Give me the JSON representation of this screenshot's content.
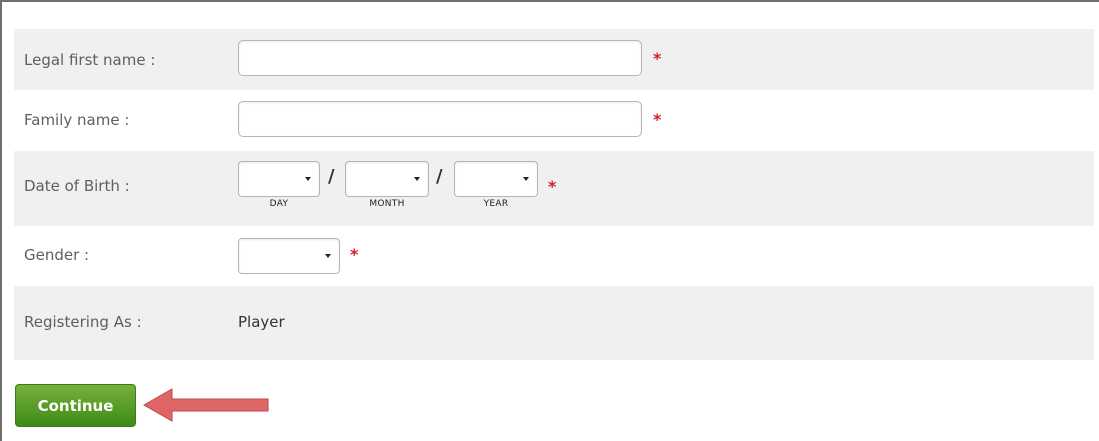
{
  "form": {
    "first_name": {
      "label": "Legal first name :",
      "value": "",
      "required_marker": "*"
    },
    "family_name": {
      "label": "Family name :",
      "value": "",
      "required_marker": "*"
    },
    "dob": {
      "label": "Date of Birth :",
      "separator": "/",
      "day_caption": "DAY",
      "month_caption": "MONTH",
      "year_caption": "YEAR",
      "required_marker": "*"
    },
    "gender": {
      "label": "Gender :",
      "required_marker": "*"
    },
    "registering_as": {
      "label": "Registering As :",
      "value": "Player"
    }
  },
  "actions": {
    "continue_label": "Continue"
  },
  "colors": {
    "required": "#d31f24",
    "button": "#4f9a22",
    "arrow": "#e06666",
    "row_shade": "#f0f0f0"
  },
  "annotation": {
    "icon": "arrow-left-icon"
  }
}
